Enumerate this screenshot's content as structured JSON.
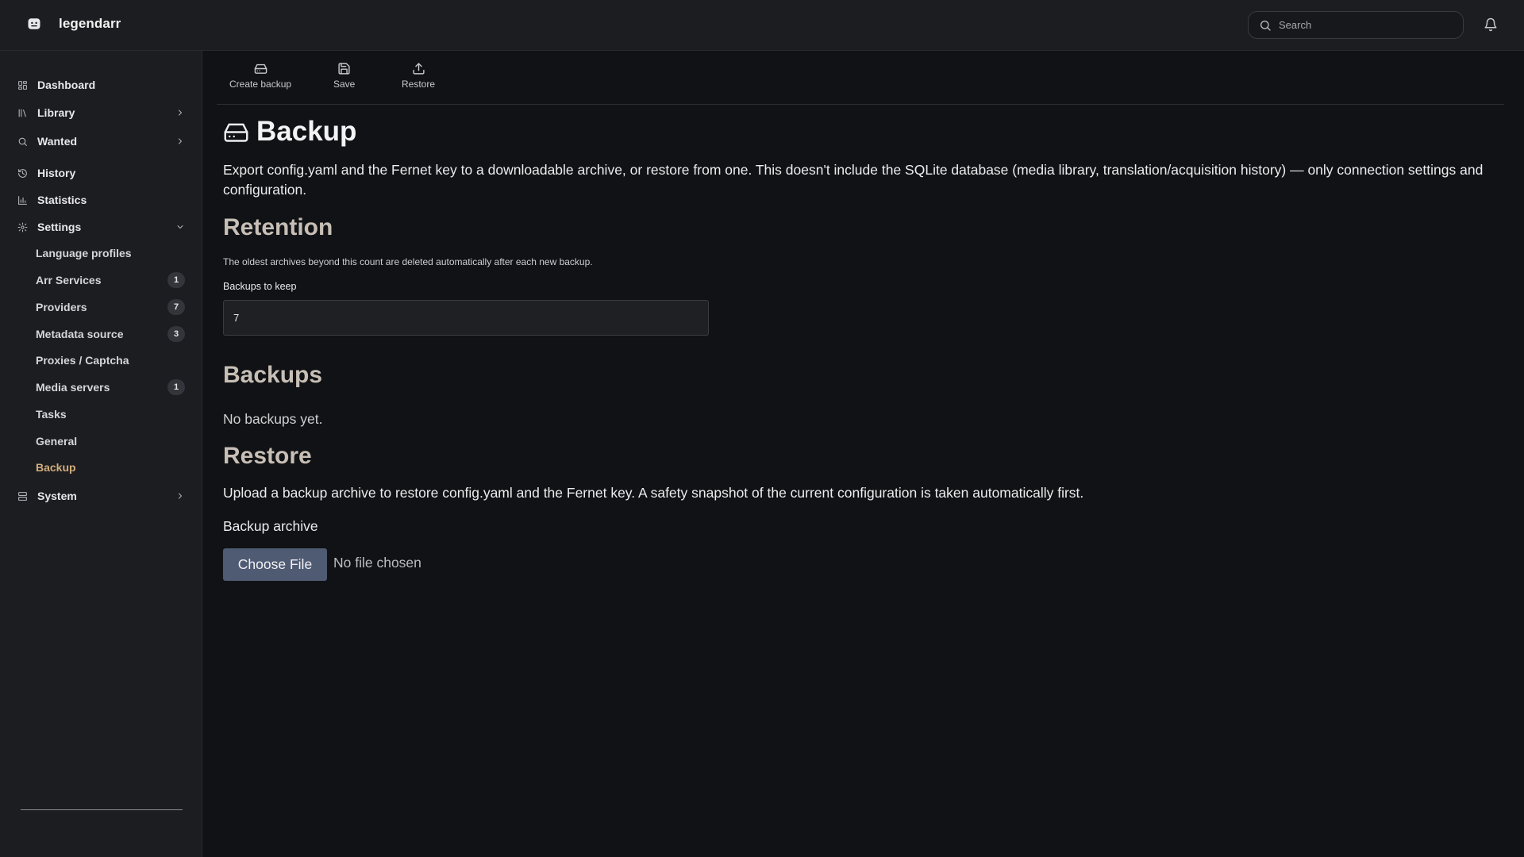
{
  "app": {
    "name": "legendarr"
  },
  "search": {
    "placeholder": "Search"
  },
  "sidebar": {
    "items": [
      {
        "label": "Dashboard"
      },
      {
        "label": "Library"
      },
      {
        "label": "Wanted"
      },
      {
        "label": "History"
      },
      {
        "label": "Statistics"
      },
      {
        "label": "Settings"
      },
      {
        "label": "System"
      }
    ],
    "settings_sub": [
      {
        "label": "Language profiles"
      },
      {
        "label": "Arr Services",
        "badge": "1"
      },
      {
        "label": "Providers",
        "badge": "7"
      },
      {
        "label": "Metadata source",
        "badge": "3"
      },
      {
        "label": "Proxies / Captcha"
      },
      {
        "label": "Media servers",
        "badge": "1"
      },
      {
        "label": "Tasks"
      },
      {
        "label": "General"
      },
      {
        "label": "Backup",
        "active": true
      }
    ]
  },
  "toolbar": {
    "create_label": "Create backup",
    "save_label": "Save",
    "restore_label": "Restore"
  },
  "page": {
    "title": "Backup",
    "description": "Export config.yaml and the Fernet key to a downloadable archive, or restore from one. This doesn't include the SQLite database (media library, translation/acquisition history) — only connection settings and configuration."
  },
  "retention": {
    "heading": "Retention",
    "help": "The oldest archives beyond this count are deleted automatically after each new backup.",
    "field_label": "Backups to keep",
    "value": "7"
  },
  "backups": {
    "heading": "Backups",
    "empty": "No backups yet."
  },
  "restore": {
    "heading": "Restore",
    "description": "Upload a backup archive to restore config.yaml and the Fernet key. A safety snapshot of the current configuration is taken automatically first.",
    "field_label": "Backup archive",
    "button": "Choose File",
    "file_status": "No file chosen"
  },
  "colors": {
    "accent": "#d2ad7c",
    "background": "#111215",
    "sidebar": "#1c1d21",
    "button": "#4f5a73"
  },
  "icons": {
    "brand": "app-logo-icon",
    "search": "search-icon",
    "notifications": "bell-icon",
    "theme": "sun-icon",
    "repo": "github-icon"
  }
}
